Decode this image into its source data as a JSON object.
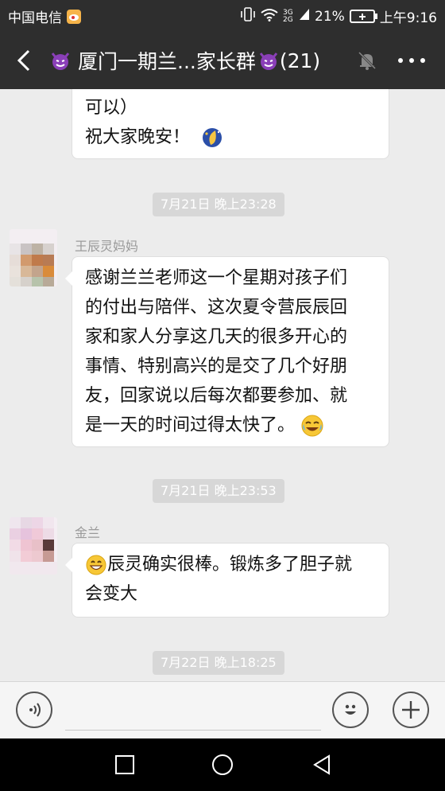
{
  "status_bar": {
    "carrier": "中国电信",
    "signal": "3G 2G",
    "battery": "21%",
    "time": "上午9:16"
  },
  "header": {
    "title_prefix": "厦门一期兰...家长群",
    "member_count": "(21)"
  },
  "messages": [
    {
      "type": "text",
      "lines": [
        "可以）",
        "祝大家晚安！"
      ]
    },
    {
      "type": "time",
      "text": "7月21日 晚上23:28"
    },
    {
      "type": "text",
      "sender": "王辰灵妈妈",
      "lines": [
        "感谢兰兰老师这一个星期对孩子们",
        "的付出与陪伴、这次夏令营辰辰回",
        "家和家人分享这几天的很多开心的",
        "事情、特别高兴的是交了几个好朋",
        "友，回家说以后每次都要参加、就",
        "是一天的时间过得太快了。"
      ]
    },
    {
      "type": "time",
      "text": "7月21日 晚上23:53"
    },
    {
      "type": "text",
      "sender": "金兰",
      "lines": [
        "辰灵确实很棒。锻炼多了胆子就",
        "会变大"
      ]
    },
    {
      "type": "time",
      "text": "7月22日 晚上18:25"
    }
  ],
  "colors": {
    "header_bg": "#2e2e2e",
    "chat_bg": "#ececec",
    "time_badge": "#d7d7d7"
  },
  "icons": {
    "back": "chevron-left-icon",
    "mute": "mute-bell-icon",
    "more": "more-dots-icon",
    "voice": "voice-icon",
    "emoji": "smiley-icon",
    "add": "plus-icon"
  }
}
